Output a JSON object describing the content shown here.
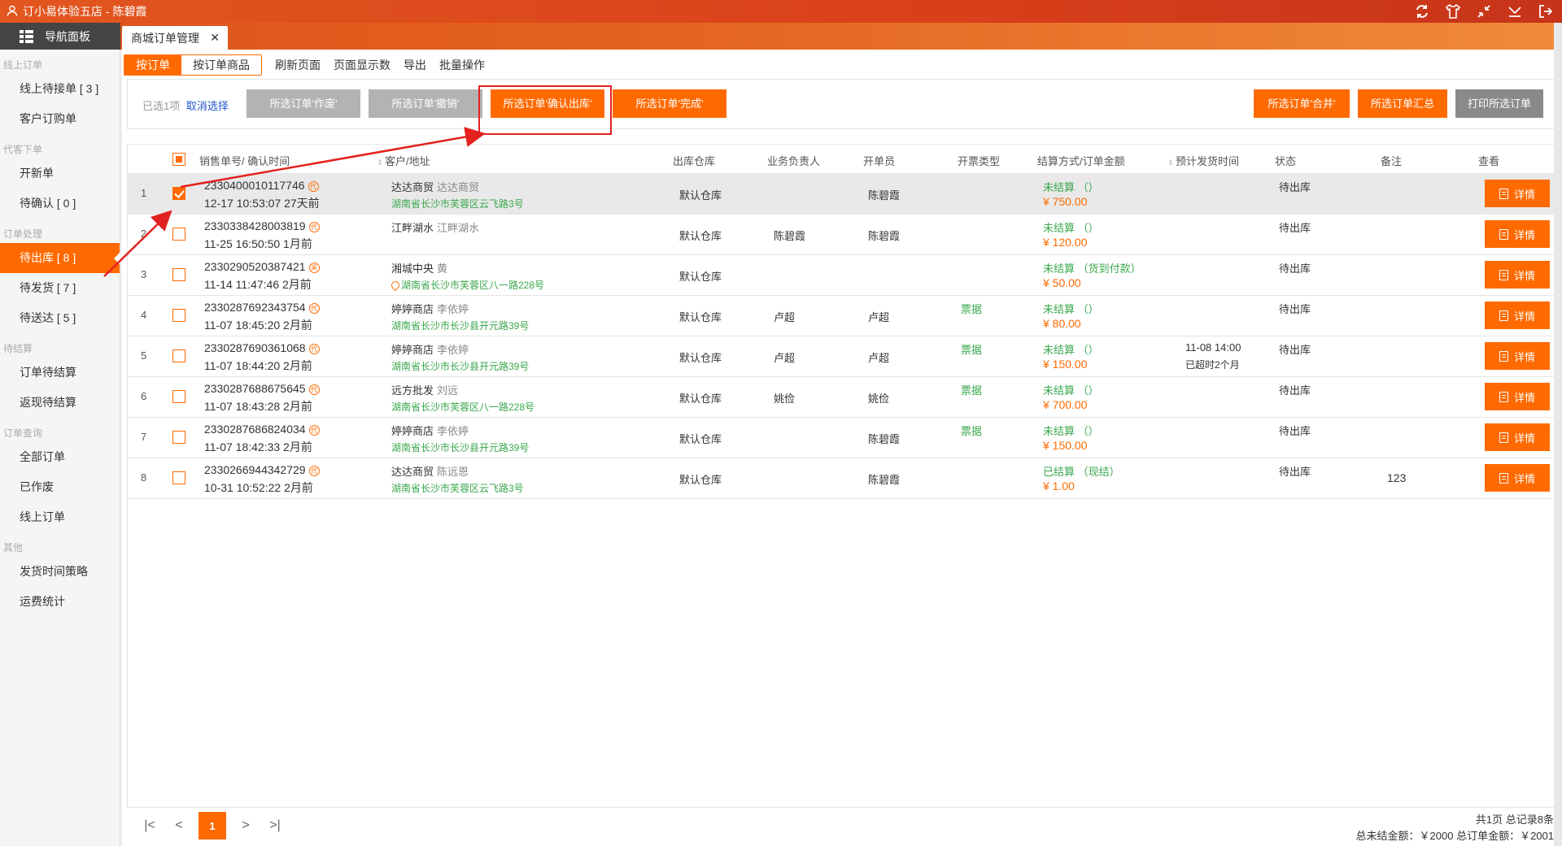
{
  "window": {
    "title": "订小易体验五店 - 陈碧霞"
  },
  "tabbar": {
    "nav_label": "导航面板",
    "active_tab": "商城订单管理",
    "close": "✕"
  },
  "sidebar": [
    {
      "group": "线上订单",
      "items": [
        {
          "label": "线上待接单 [ 3 ]",
          "active": false
        },
        {
          "label": "客户订购单",
          "active": false
        }
      ]
    },
    {
      "group": "代客下单",
      "items": [
        {
          "label": "开新单",
          "active": false
        },
        {
          "label": "待确认 [ 0 ]",
          "active": false
        }
      ]
    },
    {
      "group": "订单处理",
      "items": [
        {
          "label": "待出库 [ 8 ]",
          "active": true
        },
        {
          "label": "待发货 [ 7 ]",
          "active": false
        },
        {
          "label": "待送达 [ 5 ]",
          "active": false
        }
      ]
    },
    {
      "group": "待结算",
      "items": [
        {
          "label": "订单待结算",
          "active": false
        },
        {
          "label": "返现待结算",
          "active": false
        }
      ]
    },
    {
      "group": "订单查询",
      "items": [
        {
          "label": "全部订单",
          "active": false
        },
        {
          "label": "已作废",
          "active": false
        },
        {
          "label": "线上订单",
          "active": false
        }
      ]
    },
    {
      "group": "其他",
      "items": [
        {
          "label": "发货时间策略",
          "active": false
        },
        {
          "label": "运费统计",
          "active": false
        }
      ]
    }
  ],
  "toolbar": {
    "seg_by_order": "按订单",
    "seg_by_goods": "按订单商品",
    "refresh": "刷新页面",
    "page_size": "页面显示数",
    "export": "导出",
    "batch": "批量操作"
  },
  "actions": {
    "selected": "已选1项",
    "cancel_select": "取消选择",
    "void": "所选订单'作废'",
    "revoke": "所选订单'撤销'",
    "confirm_out": "所选订单'确认出库'",
    "complete": "所选订单'完成'",
    "merge": "所选订单'合并'",
    "summary": "所选订单汇总",
    "print": "打印所选订单"
  },
  "table": {
    "headers": {
      "order": "销售单号/ 确认时间",
      "customer": "客户/地址",
      "warehouse": "出库仓库",
      "biz": "业务负责人",
      "maker": "开单员",
      "invoice": "开票类型",
      "payment": "结算方式/订单金额",
      "ship": "预计发货时间",
      "status": "状态",
      "note": "备注",
      "view": "查看"
    },
    "detail_label": "详情",
    "rows": [
      {
        "idx": "1",
        "no": "2330400010117746",
        "badge": "代",
        "time": "12-17 10:53:07 27天前",
        "cust": "达达商贸",
        "contact": "达达商贸",
        "addr": "湖南省长沙市芙蓉区云飞路3号",
        "pin": false,
        "wh": "默认仓库",
        "biz": "",
        "maker": "陈碧霞",
        "inv": "",
        "pay": "未结算 （）",
        "amt": "¥ 750.00",
        "ship1": "",
        "ship2": "",
        "status": "待出库",
        "note": "",
        "checked": true
      },
      {
        "idx": "2",
        "no": "2330338428003819",
        "badge": "代",
        "time": "11-25 16:50:50 1月前",
        "cust": "江畔湖水",
        "contact": "江畔湖水",
        "addr": "",
        "pin": false,
        "wh": "默认仓库",
        "biz": "陈碧霞",
        "maker": "陈碧霞",
        "inv": "",
        "pay": "未结算 （）",
        "amt": "¥ 120.00",
        "ship1": "",
        "ship2": "",
        "status": "待出库",
        "note": "",
        "checked": false
      },
      {
        "idx": "3",
        "no": "2330290520387421",
        "badge": "采",
        "time": "11-14 11:47:46 2月前",
        "cust": "湘城中央",
        "contact": "黄",
        "addr": "湖南省长沙市芙蓉区八一路228号",
        "pin": true,
        "wh": "默认仓库",
        "biz": "",
        "maker": "",
        "inv": "",
        "pay": "未结算 （货到付款）",
        "amt": "¥ 50.00",
        "ship1": "",
        "ship2": "",
        "status": "待出库",
        "note": "",
        "checked": false
      },
      {
        "idx": "4",
        "no": "2330287692343754",
        "badge": "代",
        "time": "11-07 18:45:20 2月前",
        "cust": "婷婷商店",
        "contact": "李依婷",
        "addr": "湖南省长沙市长沙县开元路39号",
        "pin": false,
        "wh": "默认仓库",
        "biz": "卢超",
        "maker": "卢超",
        "inv": "票据",
        "pay": "未结算 （）",
        "amt": "¥ 80.00",
        "ship1": "",
        "ship2": "",
        "status": "待出库",
        "note": "",
        "checked": false
      },
      {
        "idx": "5",
        "no": "2330287690361068",
        "badge": "代",
        "time": "11-07 18:44:20 2月前",
        "cust": "婷婷商店",
        "contact": "李依婷",
        "addr": "湖南省长沙市长沙县开元路39号",
        "pin": false,
        "wh": "默认仓库",
        "biz": "卢超",
        "maker": "卢超",
        "inv": "票据",
        "pay": "未结算 （）",
        "amt": "¥ 150.00",
        "ship1": "11-08 14:00",
        "ship2": "已超时2个月",
        "status": "待出库",
        "note": "",
        "checked": false
      },
      {
        "idx": "6",
        "no": "2330287688675645",
        "badge": "代",
        "time": "11-07 18:43:28 2月前",
        "cust": "远方批发",
        "contact": "刘远",
        "addr": "湖南省长沙市芙蓉区八一路228号",
        "pin": false,
        "wh": "默认仓库",
        "biz": "姚俭",
        "maker": "姚俭",
        "inv": "票据",
        "pay": "未结算 （）",
        "amt": "¥ 700.00",
        "ship1": "",
        "ship2": "",
        "status": "待出库",
        "note": "",
        "checked": false
      },
      {
        "idx": "7",
        "no": "2330287686824034",
        "badge": "代",
        "time": "11-07 18:42:33 2月前",
        "cust": "婷婷商店",
        "contact": "李依婷",
        "addr": "湖南省长沙市长沙县开元路39号",
        "pin": false,
        "wh": "默认仓库",
        "biz": "",
        "maker": "陈碧霞",
        "inv": "票据",
        "pay": "未结算 （）",
        "amt": "¥ 150.00",
        "ship1": "",
        "ship2": "",
        "status": "待出库",
        "note": "",
        "checked": false
      },
      {
        "idx": "8",
        "no": "2330266944342729",
        "badge": "代",
        "time": "10-31 10:52:22 2月前",
        "cust": "达达商贸",
        "contact": "陈远恩",
        "addr": "湖南省长沙市芙蓉区云飞路3号",
        "pin": false,
        "wh": "默认仓库",
        "biz": "",
        "maker": "陈碧霞",
        "inv": "",
        "pay": "已结算 （现结）",
        "amt": "¥ 1.00",
        "ship1": "",
        "ship2": "",
        "status": "待出库",
        "note": "123",
        "checked": false
      }
    ]
  },
  "pager": {
    "first": "|<",
    "prev": "<",
    "current": "1",
    "next": ">",
    "last": ">|",
    "info": "共1页  总记录8条",
    "totals": "总未结金额：￥2000 总订单金额：￥2001"
  }
}
